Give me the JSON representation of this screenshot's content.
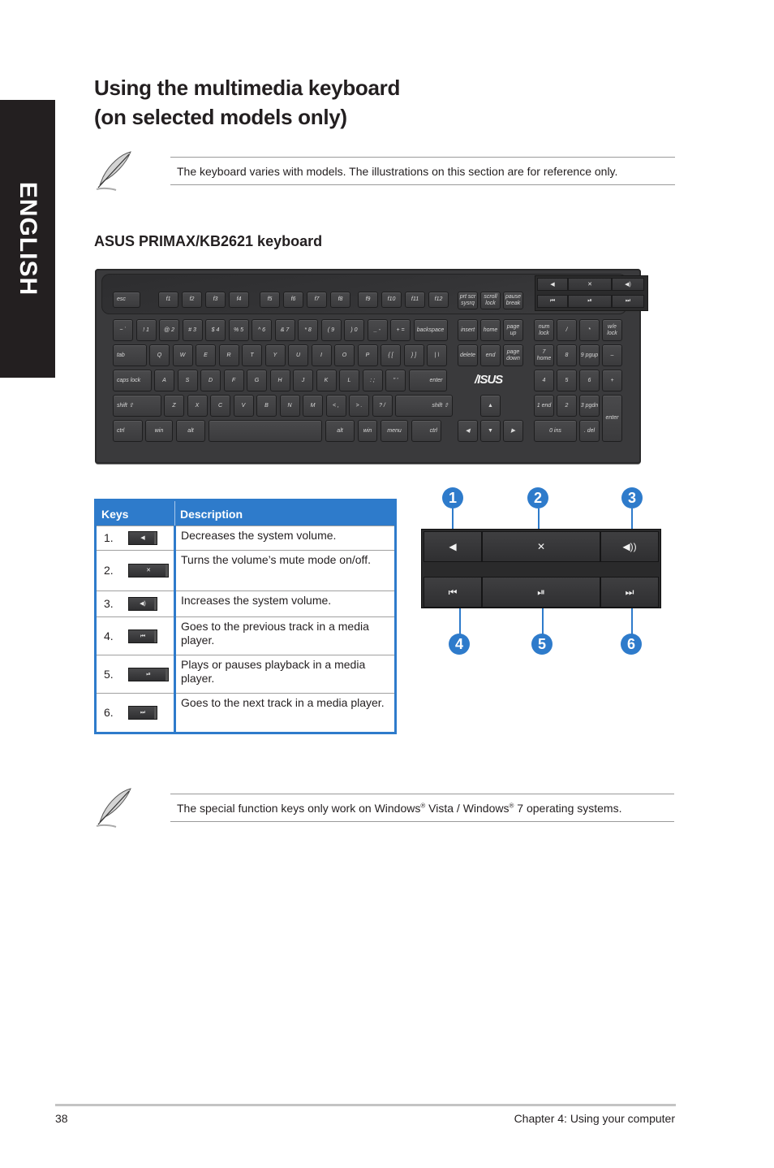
{
  "side_tab": {
    "label": "ENGLISH"
  },
  "title": {
    "line1": "Using the multimedia keyboard",
    "line2": "(on selected models only)"
  },
  "notes": [
    {
      "icon": "feather-pen-icon",
      "text": "The keyboard varies with models. The illustrations on this section are for reference only."
    },
    {
      "icon": "feather-pen-icon",
      "text_parts": [
        "The special function keys only work on Windows",
        "®",
        " Vista / Windows",
        "®",
        " 7 operating systems."
      ]
    }
  ],
  "keyboard_section": {
    "heading": "ASUS PRIMAX/KB2621 keyboard",
    "brand": "/ISUS",
    "keys": {
      "esc": "esc",
      "fkeys": [
        "f1",
        "f2",
        "f3",
        "f4",
        "f5",
        "f6",
        "f7",
        "f8",
        "f9",
        "f10",
        "f11",
        "f12"
      ],
      "sys": [
        "prt scr sysrq",
        "scroll lock",
        "pause break"
      ],
      "number_row": [
        "~ `",
        "! 1",
        "@ 2",
        "# 3",
        "$ 4",
        "% 5",
        "^ 6",
        "& 7",
        "* 8",
        "( 9",
        ") 0",
        "_ -",
        "+ =",
        "backspace"
      ],
      "qwerty_row": [
        "tab",
        "Q",
        "W",
        "E",
        "R",
        "T",
        "Y",
        "U",
        "I",
        "O",
        "P",
        "{ [",
        "} ]",
        "| \\"
      ],
      "home_row": [
        "caps lock",
        "A",
        "S",
        "D",
        "F",
        "G",
        "H",
        "J",
        "K",
        "L",
        ": ;",
        "\" '",
        "enter"
      ],
      "shift_row": [
        "shift ⇧",
        "Z",
        "X",
        "C",
        "V",
        "B",
        "N",
        "M",
        "< ,",
        "> .",
        "? /",
        "shift ⇧"
      ],
      "bottom_row": [
        "ctrl",
        "win",
        "alt",
        "",
        "alt",
        "win",
        "menu",
        "ctrl"
      ],
      "nav": [
        "insert",
        "home",
        "page up",
        "delete",
        "end",
        "page down"
      ],
      "arrows": [
        "▲",
        "◀",
        "▼",
        "▶"
      ],
      "numpad": [
        "num lock",
        "/",
        "*",
        "w/e lock",
        "7 home",
        "8",
        "9 pgup",
        "–",
        "4",
        "5",
        "6",
        "+",
        "1 end",
        "2",
        "3 pgdn",
        "enter",
        "0 ins",
        ". del"
      ]
    }
  },
  "key_table": {
    "headers": [
      "Keys",
      "Description"
    ],
    "rows": [
      {
        "num": "1.",
        "key_icon": "volume-down-icon",
        "glyph": "◀",
        "description": "Decreases the system volume."
      },
      {
        "num": "2.",
        "key_icon": "mute-icon",
        "glyph": "✕",
        "description": "Turns the volume’s mute mode on/off."
      },
      {
        "num": "3.",
        "key_icon": "volume-up-icon",
        "glyph": "◀)",
        "description": "Increases the system volume."
      },
      {
        "num": "4.",
        "key_icon": "previous-track-icon",
        "glyph": "⏮",
        "description": "Goes to the previous track in a media player."
      },
      {
        "num": "5.",
        "key_icon": "play-pause-icon",
        "glyph": "⏯",
        "description": "Plays or pauses playback in a media player."
      },
      {
        "num": "6.",
        "key_icon": "next-track-icon",
        "glyph": "⏭",
        "description": "Goes to the next track in a media player."
      }
    ]
  },
  "callout_diagram": {
    "badges": [
      "1",
      "2",
      "3",
      "4",
      "5",
      "6"
    ],
    "keys": [
      {
        "icon": "volume-down-icon",
        "glyph": "◀"
      },
      {
        "icon": "mute-icon",
        "glyph": "✕"
      },
      {
        "icon": "volume-up-icon",
        "glyph": "◀))"
      },
      {
        "icon": "previous-track-icon",
        "glyph": "⏮"
      },
      {
        "icon": "play-pause-icon",
        "glyph": "⏯"
      },
      {
        "icon": "next-track-icon",
        "glyph": "⏭"
      }
    ]
  },
  "footer": {
    "page_number": "38",
    "chapter": "Chapter 4: Using your computer"
  },
  "colors": {
    "accent_blue": "#2e7bcb",
    "side_tab": "#231f20",
    "keyboard_body": "#3a3a3c"
  }
}
